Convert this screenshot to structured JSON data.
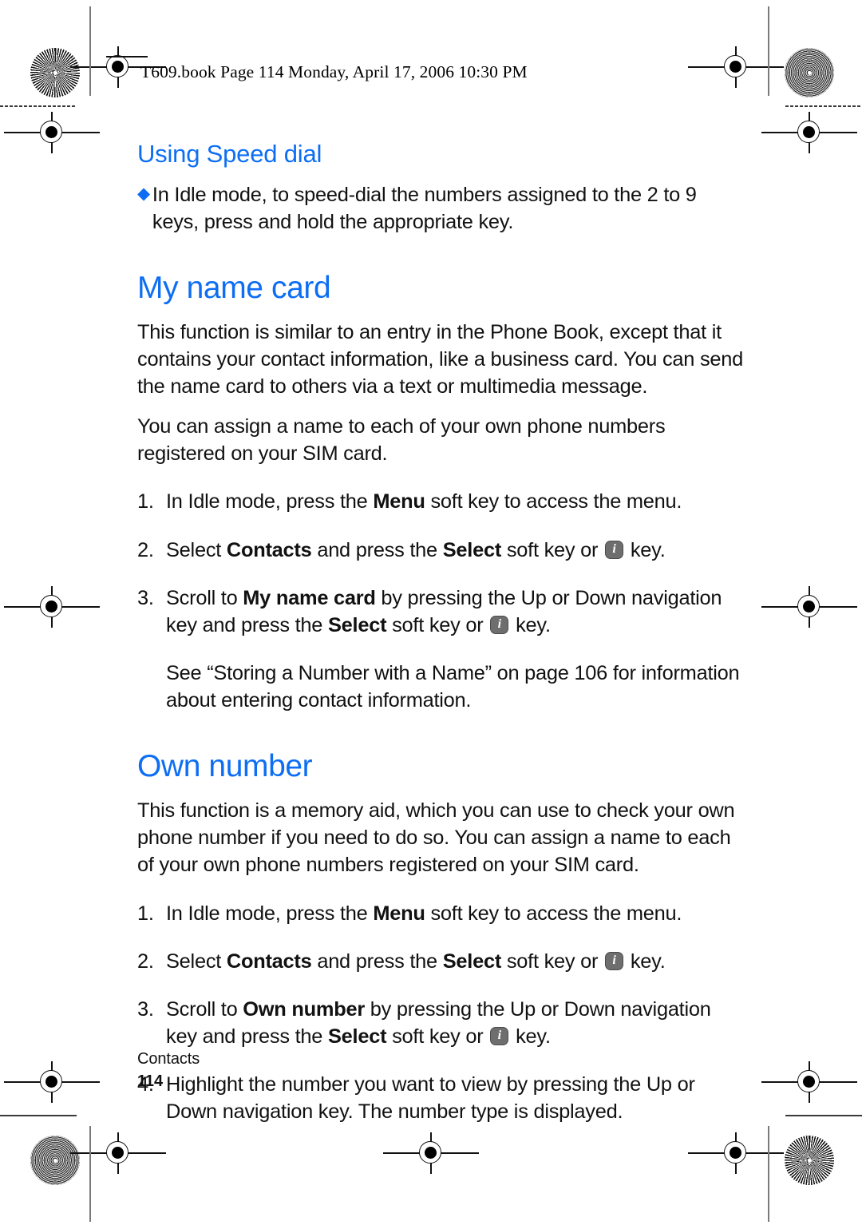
{
  "page": {
    "slug": "T609.book  Page 114  Monday, April 17, 2006  10:30 PM",
    "footer_section": "Contacts",
    "footer_page": "114",
    "heading_color": "#0d6ef4"
  },
  "speed_dial": {
    "heading": "Using Speed dial",
    "bullet": "In Idle mode, to speed-dial the numbers assigned to the 2 to 9 keys, press and hold the appropriate key."
  },
  "name_card": {
    "heading": "My name card",
    "para1": "This function is similar to an entry in the Phone Book, except that it contains your contact information, like a business card. You can send the name card to others via a text or multimedia message.",
    "para2": "You can assign a name to each of your own phone numbers registered on your SIM card.",
    "steps": [
      {
        "num": "1.",
        "parts": [
          {
            "t": "In Idle mode, press the "
          },
          {
            "t": "Menu",
            "b": true
          },
          {
            "t": " soft key to access the menu."
          }
        ]
      },
      {
        "num": "2.",
        "parts": [
          {
            "t": "Select "
          },
          {
            "t": "Contacts",
            "b": true
          },
          {
            "t": " and press the "
          },
          {
            "t": "Select",
            "b": true
          },
          {
            "t": " soft key or "
          },
          {
            "icon": "confirm-i-key"
          },
          {
            "t": " key."
          }
        ]
      },
      {
        "num": "3.",
        "parts": [
          {
            "t": "Scroll to "
          },
          {
            "t": "My name card",
            "b": true
          },
          {
            "t": " by pressing the Up or Down navigation key and press the "
          },
          {
            "t": "Select",
            "b": true
          },
          {
            "t": " soft key or "
          },
          {
            "icon": "confirm-i-key"
          },
          {
            "t": " key."
          }
        ]
      }
    ],
    "note": "See “Storing a Number with a Name” on page 106 for information about entering contact information."
  },
  "own_number": {
    "heading": "Own number",
    "para1": "This function is a memory aid, which you can use to check your own phone number if you need to do so. You can assign a name to each of your own phone numbers registered on your SIM card.",
    "steps": [
      {
        "num": "1.",
        "parts": [
          {
            "t": "In Idle mode, press the "
          },
          {
            "t": "Menu",
            "b": true
          },
          {
            "t": " soft key to access the menu."
          }
        ]
      },
      {
        "num": "2.",
        "parts": [
          {
            "t": "Select "
          },
          {
            "t": "Contacts",
            "b": true
          },
          {
            "t": " and press the "
          },
          {
            "t": "Select",
            "b": true
          },
          {
            "t": " soft key or "
          },
          {
            "icon": "confirm-i-key"
          },
          {
            "t": " key."
          }
        ]
      },
      {
        "num": "3.",
        "parts": [
          {
            "t": "Scroll to "
          },
          {
            "t": "Own number",
            "b": true
          },
          {
            "t": " by pressing the Up or Down navigation key and press the "
          },
          {
            "t": "Select",
            "b": true
          },
          {
            "t": " soft key or "
          },
          {
            "icon": "confirm-i-key"
          },
          {
            "t": " key."
          }
        ]
      },
      {
        "num": "4.",
        "parts": [
          {
            "t": "Highlight the number you want to view by pressing the Up or Down navigation key. The number type is displayed."
          }
        ]
      }
    ]
  }
}
